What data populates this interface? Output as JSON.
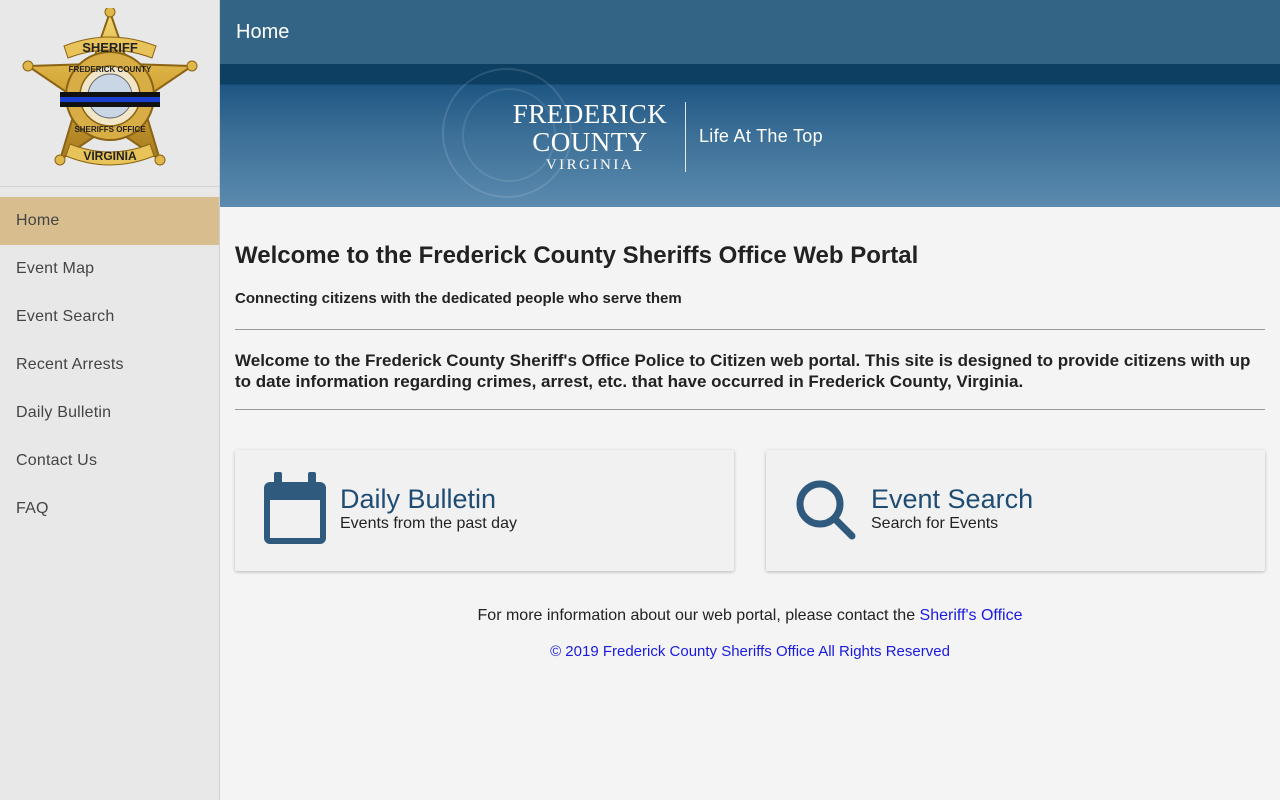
{
  "sidebar": {
    "badge": {
      "top_text": "SHERIFF",
      "ring_text": "FREDERICK COUNTY",
      "bottom_text": "SHERIFFS OFFICE",
      "banner_text": "VIRGINIA"
    },
    "items": [
      {
        "label": "Home",
        "active": true
      },
      {
        "label": "Event Map"
      },
      {
        "label": "Event Search"
      },
      {
        "label": "Recent Arrests"
      },
      {
        "label": "Daily Bulletin"
      },
      {
        "label": "Contact Us"
      },
      {
        "label": "FAQ"
      }
    ]
  },
  "header": {
    "title": "Home",
    "banner": {
      "line1": "FREDERICK",
      "line2": "COUNTY",
      "line3": "VIRGINIA",
      "tagline": "Life At The Top"
    }
  },
  "main": {
    "title": "Welcome to the Frederick County Sheriffs Office Web Portal",
    "subtitle": "Connecting citizens with the dedicated people who serve them",
    "intro": "Welcome to the Frederick County Sheriff's Office Police to Citizen web portal. This site is designed to provide citizens with up to date information regarding crimes, arrest, etc. that have occurred in Frederick County, Virginia.",
    "cards": [
      {
        "title": "Daily Bulletin",
        "desc": "Events from the past day",
        "icon": "calendar-icon"
      },
      {
        "title": "Event Search",
        "desc": "Search for Events",
        "icon": "search-icon"
      }
    ]
  },
  "footer": {
    "info_text": "For more information about our web portal, please contact the ",
    "info_link": "Sheriff's Office",
    "copyright": "© 2019 Frederick County Sheriffs Office All Rights Reserved"
  },
  "colors": {
    "header_bg": "#336486",
    "active_nav": "#d8bd8e",
    "card_title": "#1f4c73",
    "link": "#1a1adf",
    "icon": "#2f5a7d"
  }
}
